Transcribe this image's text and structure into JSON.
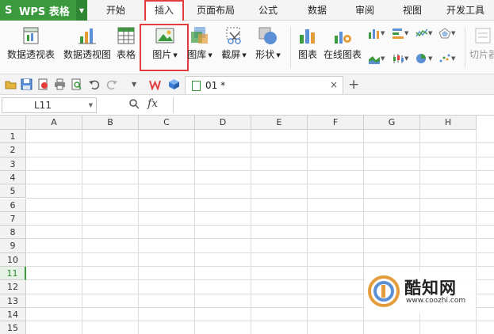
{
  "app": {
    "title": "WPS 表格",
    "logo_letter": "S"
  },
  "menu": {
    "tabs": [
      {
        "label": "开始"
      },
      {
        "label": "插入",
        "active": true
      },
      {
        "label": "页面布局"
      },
      {
        "label": "公式"
      },
      {
        "label": "数据"
      },
      {
        "label": "审阅"
      },
      {
        "label": "视图"
      },
      {
        "label": "开发工具"
      }
    ]
  },
  "ribbon": {
    "pivot_table": "数据透视表",
    "pivot_chart": "数据透视图",
    "table": "表格",
    "picture": "图片",
    "gallery": "图库",
    "screenshot": "截屏",
    "shapes": "形状",
    "chart": "图表",
    "online_chart": "在线图表",
    "slicer": "切片器"
  },
  "document": {
    "tab_name": "01 *",
    "close": "×",
    "add": "+"
  },
  "formula_bar": {
    "cell_ref": "L11",
    "fx": "fx"
  },
  "grid": {
    "columns": [
      "A",
      "B",
      "C",
      "D",
      "E",
      "F",
      "G",
      "H"
    ],
    "rows": [
      "1",
      "2",
      "3",
      "4",
      "5",
      "6",
      "7",
      "8",
      "9",
      "10",
      "11",
      "12",
      "13",
      "14",
      "15"
    ],
    "active_row": "11"
  },
  "watermark": {
    "name": "酷知网",
    "url": "www.coozhi.com"
  },
  "colors": {
    "accent_green": "#3b9a3e",
    "highlight_red": "#e43c3c"
  }
}
